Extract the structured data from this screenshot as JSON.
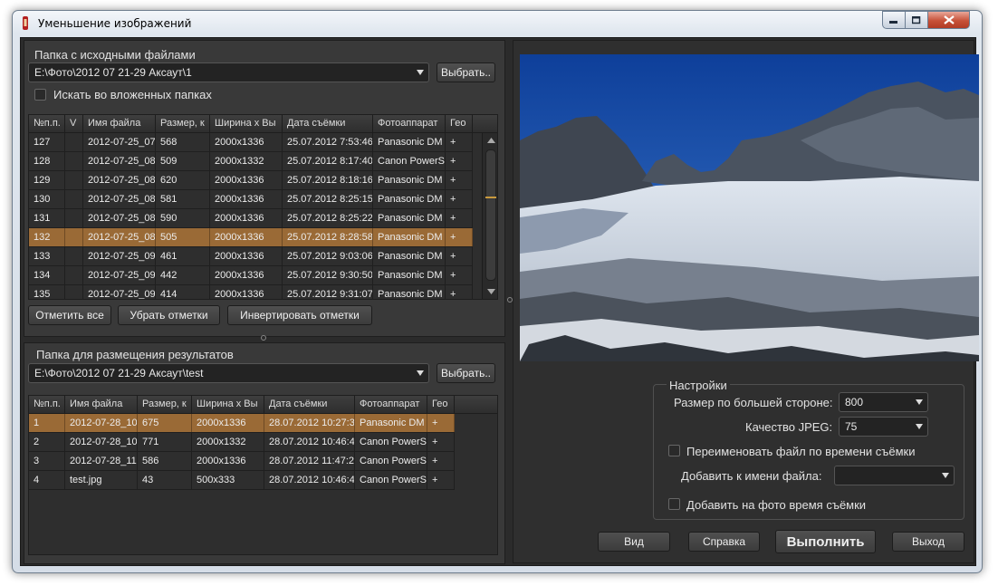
{
  "window": {
    "title": "Уменьшение изображений"
  },
  "source": {
    "group_label": "Папка с исходными файлами",
    "folder": "E:\\Фото\\2012 07 21-29 Аксаут\\1",
    "browse_label": "Выбрать..",
    "subfolders_label": "Искать во вложенных папках",
    "columns": [
      "№п.п.",
      "V",
      "Имя файла",
      "Размер, к",
      "Ширина x Вы",
      "Дата съёмки",
      "Фотоаппарат",
      "Гео"
    ],
    "rows": [
      [
        "127",
        "",
        "2012-07-25_07",
        "568",
        "2000x1336",
        "25.07.2012 7:53:46",
        "Panasonic DM",
        "+"
      ],
      [
        "128",
        "",
        "2012-07-25_08",
        "509",
        "2000x1332",
        "25.07.2012 8:17:40",
        "Canon PowerS",
        "+"
      ],
      [
        "129",
        "",
        "2012-07-25_08",
        "620",
        "2000x1336",
        "25.07.2012 8:18:16",
        "Panasonic DM",
        "+"
      ],
      [
        "130",
        "",
        "2012-07-25_08",
        "581",
        "2000x1336",
        "25.07.2012 8:25:15",
        "Panasonic DM",
        "+"
      ],
      [
        "131",
        "",
        "2012-07-25_08",
        "590",
        "2000x1336",
        "25.07.2012 8:25:22",
        "Panasonic DM",
        "+"
      ],
      [
        "132",
        "",
        "2012-07-25_08",
        "505",
        "2000x1336",
        "25.07.2012 8:28:58",
        "Panasonic DM",
        "+"
      ],
      [
        "133",
        "",
        "2012-07-25_09",
        "461",
        "2000x1336",
        "25.07.2012 9:03:06",
        "Panasonic DM",
        "+"
      ],
      [
        "134",
        "",
        "2012-07-25_09",
        "442",
        "2000x1336",
        "25.07.2012 9:30:50",
        "Panasonic DM",
        "+"
      ],
      [
        "135",
        "",
        "2012-07-25_09",
        "414",
        "2000x1336",
        "25.07.2012 9:31:07",
        "Panasonic DM",
        "+"
      ]
    ],
    "selected_row": 5,
    "mark_all_label": "Отметить все",
    "unmark_label": "Убрать отметки",
    "invert_label": "Инвертировать отметки"
  },
  "dest": {
    "group_label": "Папка для размещения результатов",
    "folder": "E:\\Фото\\2012 07 21-29 Аксаут\\test",
    "browse_label": "Выбрать..",
    "columns": [
      "№п.п.",
      "Имя файла",
      "Размер, к",
      "Ширина x Вы",
      "Дата съёмки",
      "Фотоаппарат",
      "Гео"
    ],
    "rows": [
      [
        "1",
        "2012-07-28_10",
        "675",
        "2000x1336",
        "28.07.2012 10:27:3",
        "Panasonic DM",
        "+"
      ],
      [
        "2",
        "2012-07-28_10",
        "771",
        "2000x1332",
        "28.07.2012 10:46:4",
        "Canon PowerS",
        "+"
      ],
      [
        "3",
        "2012-07-28_11",
        "586",
        "2000x1336",
        "28.07.2012 11:47:2",
        "Canon PowerS",
        "+"
      ],
      [
        "4",
        "test.jpg",
        "43",
        "500x333",
        "28.07.2012 10:46:4",
        "Canon PowerS",
        "+"
      ]
    ],
    "selected_row": 0
  },
  "settings": {
    "group_label": "Настройки",
    "max_side_label": "Размер по большей стороне:",
    "max_side_value": "800",
    "jpeg_label": "Качество JPEG:",
    "jpeg_value": "75",
    "rename_label": "Переименовать файл по времени съёмки",
    "suffix_label": "Добавить к имени файла:",
    "suffix_value": "",
    "stamp_label": "Добавить на фото время съёмки"
  },
  "actions": {
    "view_label": "Вид",
    "help_label": "Справка",
    "run_label": "Выполнить",
    "exit_label": "Выход"
  },
  "colors": {
    "selection": "#9a6a36",
    "background": "#393939"
  }
}
